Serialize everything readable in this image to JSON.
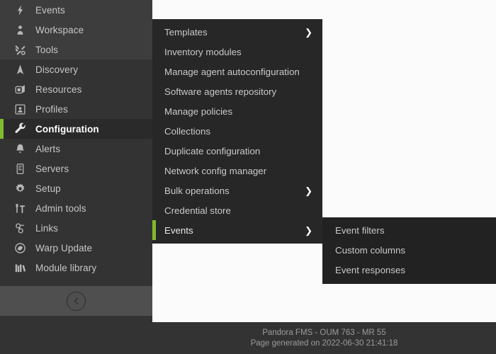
{
  "sidebar": {
    "groups": [
      {
        "shade": "a",
        "items": [
          {
            "label": "Events",
            "icon": "bolt-icon"
          },
          {
            "label": "Workspace",
            "icon": "user-icon"
          },
          {
            "label": "Tools",
            "icon": "tools-icon"
          }
        ]
      },
      {
        "shade": "b",
        "items": [
          {
            "label": "Discovery",
            "icon": "compass-icon"
          },
          {
            "label": "Resources",
            "icon": "cube-icon"
          },
          {
            "label": "Profiles",
            "icon": "profile-card-icon"
          }
        ]
      },
      {
        "shade": "active",
        "items": [
          {
            "label": "Configuration",
            "icon": "wrench-icon",
            "active": true
          }
        ]
      },
      {
        "shade": "b",
        "items": [
          {
            "label": "Alerts",
            "icon": "bell-icon"
          },
          {
            "label": "Servers",
            "icon": "server-icon"
          },
          {
            "label": "Setup",
            "icon": "gear-icon"
          },
          {
            "label": "Admin tools",
            "icon": "hammer-icon"
          },
          {
            "label": "Links",
            "icon": "link-icon"
          },
          {
            "label": "Warp Update",
            "icon": "warp-icon"
          },
          {
            "label": "Module library",
            "icon": "books-icon"
          }
        ]
      }
    ],
    "collapse_label": "collapse-sidebar",
    "accent_color": "#82b92e"
  },
  "submenu": {
    "items": [
      {
        "label": "Templates",
        "has_children": true
      },
      {
        "label": "Inventory modules",
        "has_children": false
      },
      {
        "label": "Manage agent autoconfiguration",
        "has_children": false
      },
      {
        "label": "Software agents repository",
        "has_children": false
      },
      {
        "label": "Manage policies",
        "has_children": false
      },
      {
        "label": "Collections",
        "has_children": false
      },
      {
        "label": "Duplicate configuration",
        "has_children": false
      },
      {
        "label": "Network config manager",
        "has_children": false
      },
      {
        "label": "Bulk operations",
        "has_children": true
      },
      {
        "label": "Credential store",
        "has_children": false
      },
      {
        "label": "Events",
        "has_children": true,
        "selected": true
      }
    ],
    "chevron": "❯"
  },
  "submenu3": {
    "items": [
      {
        "label": "Event filters"
      },
      {
        "label": "Custom columns"
      },
      {
        "label": "Event responses"
      }
    ]
  },
  "footer": {
    "product": "Pandora FMS - OUM 763 - MR 55",
    "generated": "Page generated on 2022-06-30 21:41:18"
  }
}
